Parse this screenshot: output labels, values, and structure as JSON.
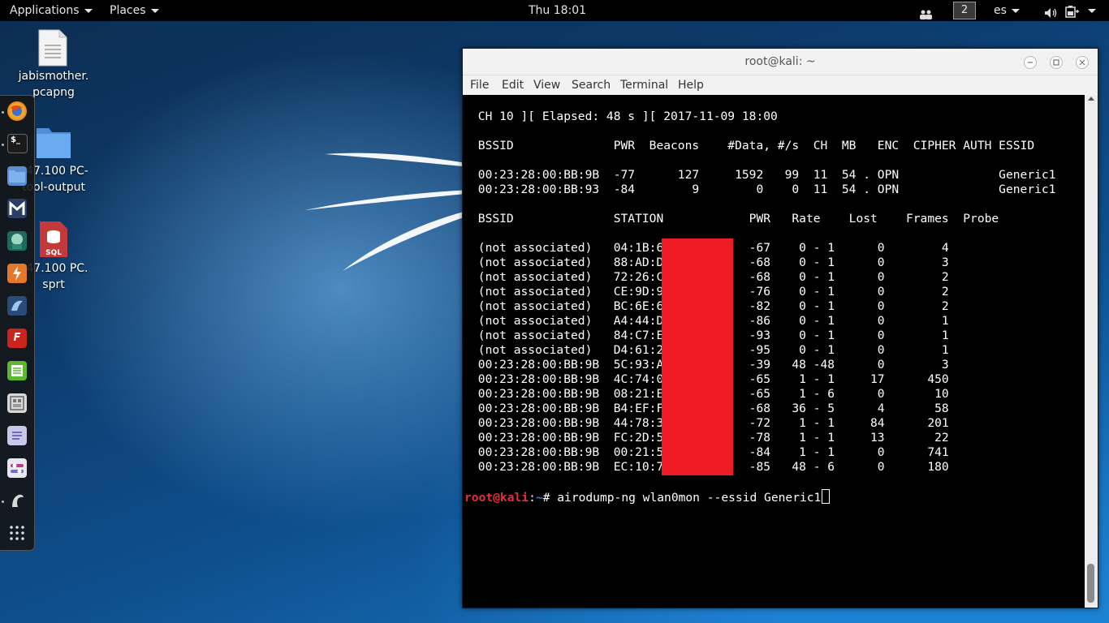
{
  "topbar": {
    "applications": "Applications",
    "places": "Places",
    "clock": "Thu 18:01",
    "workspace": "2",
    "keyboard_layout": "es",
    "icons": [
      "people-icon",
      "volume-icon",
      "battery-icon"
    ]
  },
  "desktop": {
    "files": [
      {
        "label": "jabismother.\npcapng",
        "icon": "document-icon"
      },
      {
        "label": "147.100 PC-\ntool-output",
        "icon": "folder-icon"
      },
      {
        "label": "147.100 PC.\nsprt",
        "icon": "sql-icon"
      }
    ]
  },
  "dock": {
    "apps": [
      "firefox-icon",
      "terminal-icon",
      "files-icon",
      "metasploit-icon",
      "armitage-icon",
      "burpsuite-icon",
      "beef-icon",
      "faraday-icon",
      "leafpad-icon",
      "cutycapt-icon",
      "text-editor-icon",
      "settings-icon",
      "kali-icon",
      "show-apps-icon"
    ],
    "sql_label": "SQL"
  },
  "terminal": {
    "title": "root@kali: ~",
    "menu": [
      "File",
      "Edit",
      "View",
      "Search",
      "Terminal",
      "Help"
    ],
    "status_line": " CH 10 ][ Elapsed: 48 s ][ 2017-11-09 18:00",
    "ap_header": " BSSID              PWR  Beacons    #Data, #/s  CH  MB   ENC  CIPHER AUTH ESSID",
    "ap_rows": [
      " 00:23:28:00:BB:9B  -77      127     1592   99  11  54 . OPN              Generic1",
      " 00:23:28:00:BB:93  -84        9        0    0  11  54 . OPN              Generic1"
    ],
    "station_header": " BSSID              STATION            PWR   Rate    Lost    Frames  Probe",
    "station_rows": [
      " (not associated)   04:1B:6            -67    0 - 1      0        4",
      " (not associated)   88:AD:D            -68    0 - 1      0        3",
      " (not associated)   72:26:C            -68    0 - 1      0        2",
      " (not associated)   CE:9D:9            -76    0 - 1      0        2",
      " (not associated)   BC:6E:6            -82    0 - 1      0        2",
      " (not associated)   A4:44:D            -86    0 - 1      0        1",
      " (not associated)   84:C7:E            -93    0 - 1      0        1",
      " (not associated)   D4:61:2            -95    0 - 1      0        1",
      " 00:23:28:00:BB:9B  5C:93:A            -39   48 -48      0        3",
      " 00:23:28:00:BB:9B  4C:74:0            -65    1 - 1     17      450",
      " 00:23:28:00:BB:9B  08:21:E            -65    1 - 6      0       10",
      " 00:23:28:00:BB:9B  B4:EF:F            -68   36 - 5      4       58",
      " 00:23:28:00:BB:9B  44:78:3            -72    1 - 1     84      201",
      " 00:23:28:00:BB:9B  FC:2D:5            -78    1 - 1     13       22",
      " 00:23:28:00:BB:9B  00:21:5            -84    1 - 1      0      741",
      " 00:23:28:00:BB:9B  EC:10:7            -85   48 - 6      0      180"
    ],
    "prompt_user": "root@kali",
    "prompt_sep": ":",
    "prompt_path": "~",
    "prompt_hash": "# ",
    "command": "airodump-ng wlan0mon --essid Generic1",
    "redaction_color": "#ef1c25"
  }
}
